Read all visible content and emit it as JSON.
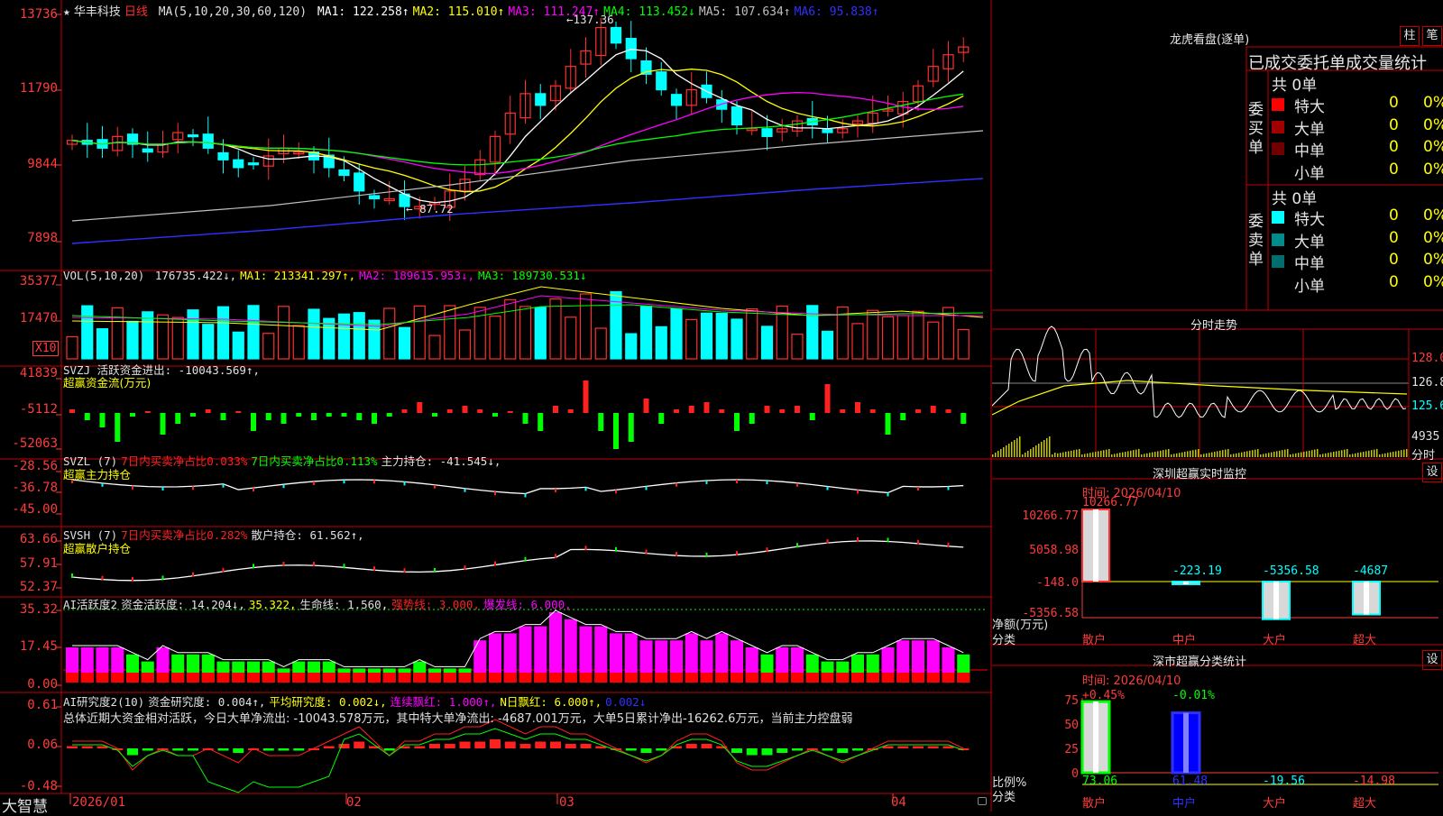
{
  "stock": {
    "star": "★",
    "name": "华丰科技",
    "period": "日线"
  },
  "ma_line": {
    "label": "MA(5,10,20,30,60,120)",
    "items": [
      {
        "text": "MA1: 122.258↑",
        "color": "#ffffff"
      },
      {
        "text": "MA2: 115.010↑",
        "color": "#ffff00"
      },
      {
        "text": "MA3: 111.247↑",
        "color": "#ff00ff"
      },
      {
        "text": "MA4: 113.452↓",
        "color": "#00ff00"
      },
      {
        "text": "MA5: 107.634↑",
        "color": "#c0c0c0"
      },
      {
        "text": "MA6: 95.838↑",
        "color": "#3030ff"
      }
    ]
  },
  "price_axis": [
    "13736",
    "11790",
    "9844",
    "7898"
  ],
  "price_marks": {
    "high": "137.36",
    "low": "87.72"
  },
  "vol": {
    "label": "VOL(5,10,20)",
    "items": [
      {
        "text": "176735.422↓,",
        "color": "#e0e0e0"
      },
      {
        "text": "MA1: 213341.297↑,",
        "color": "#ffff00"
      },
      {
        "text": "MA2: 189615.953↓,",
        "color": "#ff00ff"
      },
      {
        "text": "MA3: 189730.531↓",
        "color": "#00ff00"
      }
    ],
    "axis": [
      "35377",
      "17470"
    ],
    "unit": "X10"
  },
  "svzj": {
    "label": "SVZJ  活跃资金进出: -10043.569↑,",
    "sub": "超赢资金流(万元)",
    "axis": [
      "41839",
      "-5112",
      "-52063"
    ]
  },
  "svzl": {
    "label": "SVZL (7)",
    "items": [
      {
        "text": "7日内买卖净占比0.033%",
        "color": "#ff2020"
      },
      {
        "text": "7日内买卖净占比0.113%",
        "color": "#00ff00"
      },
      {
        "text": "主力持仓: -41.545↓,",
        "color": "#e0e0e0"
      }
    ],
    "sub": "超赢主力持仓",
    "axis": [
      "-28.56",
      "-36.78",
      "-45.00"
    ]
  },
  "svsh": {
    "label": "SVSH (7)",
    "items": [
      {
        "text": "7日内买卖净占比0.282%",
        "color": "#ff2020"
      },
      {
        "text": "散户持仓: 61.562↑,",
        "color": "#e0e0e0"
      }
    ],
    "sub": "超赢散户持仓",
    "axis": [
      "63.66",
      "57.91",
      "52.37"
    ]
  },
  "ai1": {
    "label": "AI活跃度2",
    "items": [
      {
        "text": "资金活跃度: 14.204↓,",
        "color": "#e0e0e0"
      },
      {
        "text": "35.322,",
        "color": "#ffff00"
      },
      {
        "text": "生命线: 1.560,",
        "color": "#e0e0e0"
      },
      {
        "text": "强势线: 3.000,",
        "color": "#ff2020"
      },
      {
        "text": "爆发线: 6.000,",
        "color": "#ff00ff"
      }
    ],
    "axis": [
      "35.32",
      "17.45",
      "0.00"
    ]
  },
  "ai2": {
    "label": "AI研究度2(10)",
    "items": [
      {
        "text": "资金研究度: 0.004↑,",
        "color": "#e0e0e0"
      },
      {
        "text": "平均研究度: 0.002↓,",
        "color": "#ffff00"
      },
      {
        "text": "连续飘红: 1.000↑,",
        "color": "#ff00ff"
      },
      {
        "text": "N日飘红: 6.000↑,",
        "color": "#ffff00"
      },
      {
        "text": "0.002↓",
        "color": "#3030ff"
      }
    ],
    "summary": "总体近期大资金相对活跃，今日大单净流出: -10043.578万元，其中特大单净流出: -4687.001万元，大单5日累计净出-16262.6万元，当前主力控盘弱",
    "axis": [
      "0.61",
      "0.06",
      "-0.48"
    ]
  },
  "date_axis": {
    "logo": "大智慧",
    "dates": [
      "2026/01",
      "02",
      "03",
      "04"
    ]
  },
  "right": {
    "lhb_title": "龙虎看盘(逐单)",
    "tab_bar": "柱",
    "tab_pen": "笔",
    "tabs_header": "已成交委托单成交量统计",
    "buy_side": "委买单",
    "sell_side": "委卖单",
    "buy_total": "共 0单",
    "sell_total": "共 0单",
    "buy_rows": [
      {
        "name": "特大",
        "count": "0",
        "pct": "0%",
        "color": "#ff0000"
      },
      {
        "name": "大单",
        "count": "0",
        "pct": "0%",
        "color": "#a00000"
      },
      {
        "name": "中单",
        "count": "0",
        "pct": "0%",
        "color": "#700000"
      },
      {
        "name": "小单",
        "count": "0",
        "pct": "0%",
        "color": ""
      }
    ],
    "sell_rows": [
      {
        "name": "特大",
        "count": "0",
        "pct": "0%",
        "color": "#00ffff"
      },
      {
        "name": "大单",
        "count": "0",
        "pct": "0%",
        "color": "#008c8c"
      },
      {
        "name": "中单",
        "count": "0",
        "pct": "0%",
        "color": "#006e6e"
      },
      {
        "name": "小单",
        "count": "0",
        "pct": "0%",
        "color": ""
      }
    ],
    "fenshi_title": "分时走势",
    "fenshi_axis": [
      "128.0",
      "126.8",
      "125.6"
    ],
    "fenshi_vol": "4935",
    "fenshi_unit": "分时",
    "sz_monitor": {
      "title": "深圳超赢实时监控",
      "set": "设",
      "time": "时间: 2026/04/10",
      "axis": [
        "10266.77",
        "5058.98",
        "-148.0",
        "-5356.58"
      ],
      "unit_top": "净额(万元)",
      "unit_bottom": "分类",
      "cats": [
        "散户",
        "中户",
        "大户",
        "超大"
      ],
      "values": [
        10266.77,
        -223.19,
        -5356.58,
        -4687
      ],
      "value_labels": [
        "10266.77",
        "-223.19",
        "-5356.58",
        "-4687"
      ]
    },
    "sz_class": {
      "title": "深市超赢分类统计",
      "set": "设",
      "time": "时间: 2026/04/10",
      "axis": [
        "75",
        "50",
        "25",
        "0"
      ],
      "unit_top": "比例%",
      "unit_bottom": "分类",
      "top_labels": [
        "+0.45%",
        "-0.01%"
      ],
      "cats": [
        "散户",
        "中户",
        "大户",
        "超大"
      ],
      "values": [
        73.06,
        61.48,
        -19.56,
        -14.98
      ],
      "value_labels": [
        "73.06",
        "61.48",
        "-19.56",
        "-14.98"
      ]
    }
  }
}
